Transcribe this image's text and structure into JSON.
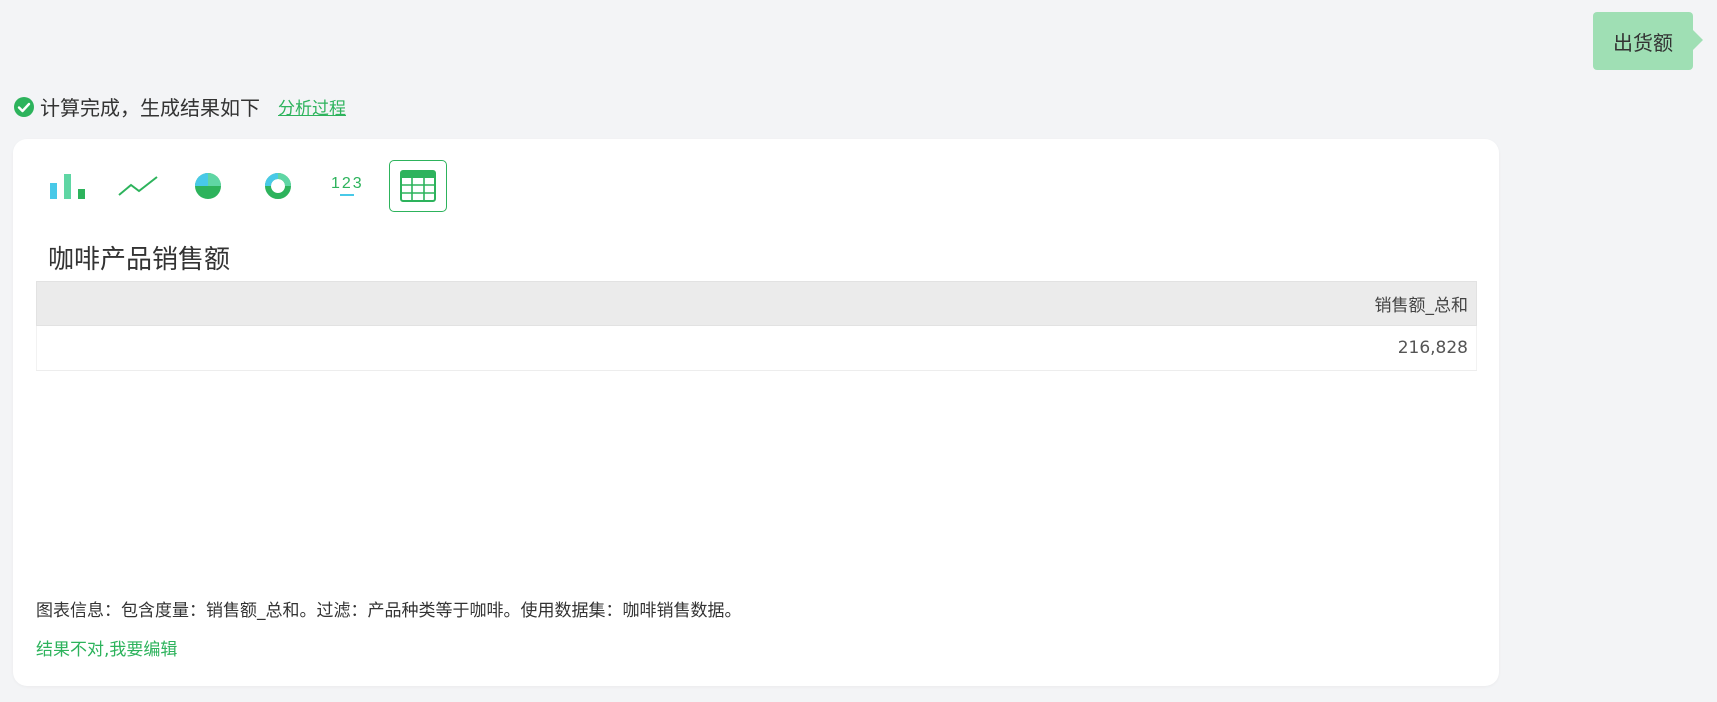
{
  "user_message": "出货额",
  "status": {
    "text": "计算完成，生成结果如下",
    "link": "分析过程"
  },
  "toolbar": {
    "buttons": [
      {
        "icon": "bar-chart-icon",
        "active": false
      },
      {
        "icon": "line-chart-icon",
        "active": false
      },
      {
        "icon": "pie-chart-icon",
        "active": false
      },
      {
        "icon": "donut-chart-icon",
        "active": false
      },
      {
        "icon": "number-123-icon",
        "label": "123",
        "active": false
      },
      {
        "icon": "table-icon",
        "active": true
      }
    ]
  },
  "chart_title": "咖啡产品销售额",
  "table": {
    "headers": [
      "销售额_总和"
    ],
    "rows": [
      [
        "216,828"
      ]
    ]
  },
  "chart_info": "图表信息：包含度量：销售额_总和。过滤：产品种类等于咖啡。使用数据集：咖啡销售数据。",
  "edit_link": "结果不对,我要编辑",
  "colors": {
    "accent": "#2db35c",
    "bubble": "#9fdfb4",
    "icon_light": "#48c9e8"
  }
}
